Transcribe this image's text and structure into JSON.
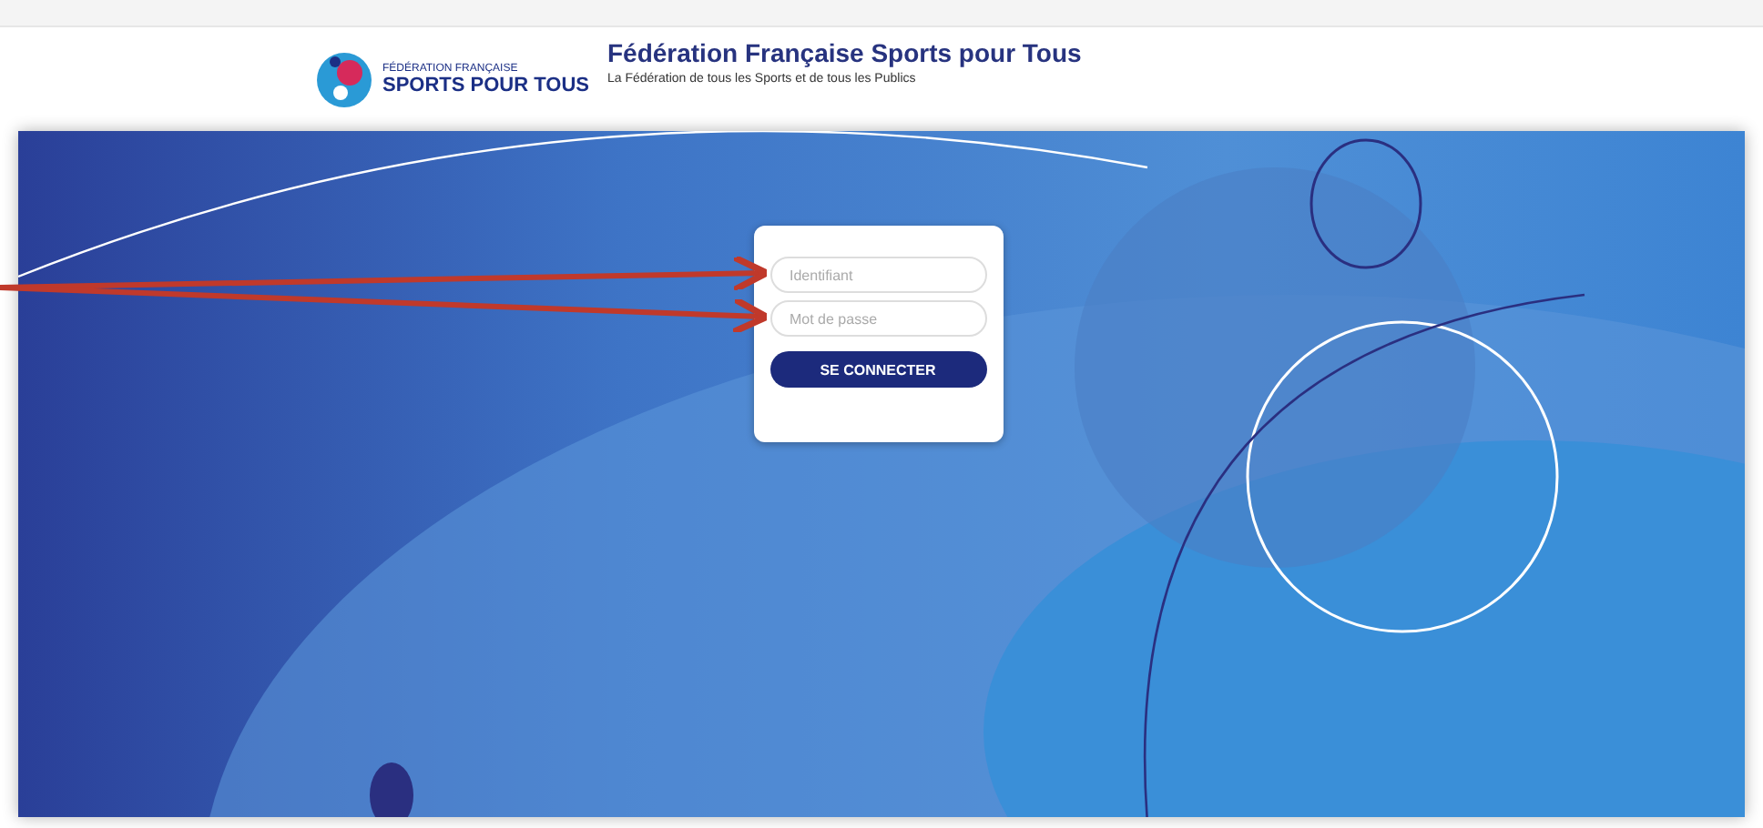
{
  "header": {
    "logo_line_1": "FÉDÉRATION FRANÇAISE",
    "logo_line_2": "SPORTS POUR TOUS",
    "title": "Fédération Française Sports pour Tous",
    "subtitle": "La Fédération de tous les Sports et de tous les Publics"
  },
  "login": {
    "fields": [
      {
        "placeholder": "Identifiant"
      },
      {
        "placeholder": "Mot de passe"
      }
    ],
    "button": "SE CONNECTER"
  },
  "annotation_arrows": [
    {
      "kind": "arrow"
    },
    {
      "kind": "arrow"
    }
  ]
}
